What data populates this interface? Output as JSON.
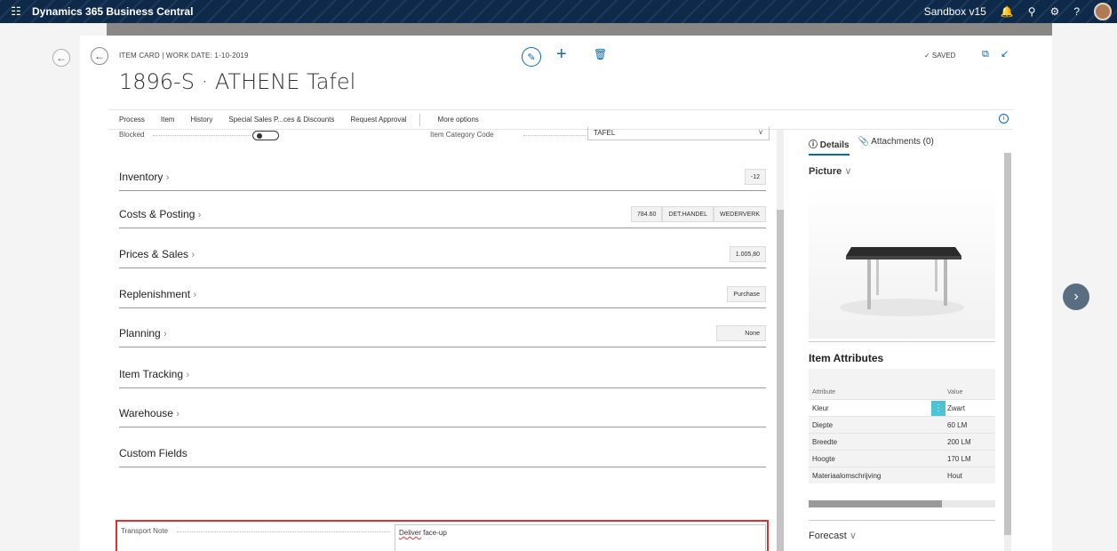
{
  "app": {
    "name": "Dynamics 365 Business Central",
    "environment": "Sandbox v15"
  },
  "page": {
    "breadcrumb": "ITEM CARD | WORK DATE: 1-10-2019",
    "title": "1896-S · ATHENE Tafel",
    "saved_label": "✓ SAVED"
  },
  "actions": [
    "Process",
    "Item",
    "History",
    "Special Sales P...ces & Discounts",
    "Request Approval"
  ],
  "more_options": "More options",
  "fields": {
    "blocked_label": "Blocked",
    "blocked_value": false,
    "item_category_label": "Item Category Code",
    "item_category_value": "TAFEL"
  },
  "sections": [
    {
      "title": "Inventory",
      "badges": [
        "-12"
      ]
    },
    {
      "title": "Costs & Posting",
      "badges": [
        "784.60",
        "DET.HANDEL",
        "WEDERVERK"
      ]
    },
    {
      "title": "Prices & Sales",
      "badges": [
        "1.005,80"
      ]
    },
    {
      "title": "Replenishment",
      "badges": [
        "Purchase"
      ]
    },
    {
      "title": "Planning",
      "badges": [
        "None"
      ]
    },
    {
      "title": "Item Tracking",
      "badges": []
    },
    {
      "title": "Warehouse",
      "badges": []
    }
  ],
  "custom_fields": {
    "title": "Custom Fields",
    "transport_note_label": "Transport Note",
    "transport_note_value_word1": "Deliver",
    "transport_note_value_rest": " face-up"
  },
  "factbox": {
    "tab_details": "Details",
    "tab_attachments": "Attachments (0)",
    "picture_title": "Picture",
    "attributes_title": "Item Attributes",
    "attr_header_attribute": "Attribute",
    "attr_header_value": "Value",
    "attributes": [
      {
        "attribute": "Kleur",
        "value": "Zwart"
      },
      {
        "attribute": "Diepte",
        "value": "60 LM"
      },
      {
        "attribute": "Breedte",
        "value": "200 LM"
      },
      {
        "attribute": "Hoogte",
        "value": "170 LM"
      },
      {
        "attribute": "Materiaalomschrijving",
        "value": "Hout"
      }
    ],
    "forecast_title": "Forecast"
  },
  "colors": {
    "topbar": "#0e2a4a",
    "accent": "#0b6aa8",
    "highlight_border": "#e03030",
    "attribute_menu": "#4fc3d4"
  },
  "icons": [
    "waffle-icon",
    "back-icon",
    "edit-icon",
    "plus-icon",
    "delete-icon",
    "open-new-window-icon",
    "collapse-icon",
    "info-icon",
    "notification-icon",
    "search-icon",
    "settings-icon",
    "help-icon",
    "next-record-icon",
    "attachment-icon"
  ]
}
